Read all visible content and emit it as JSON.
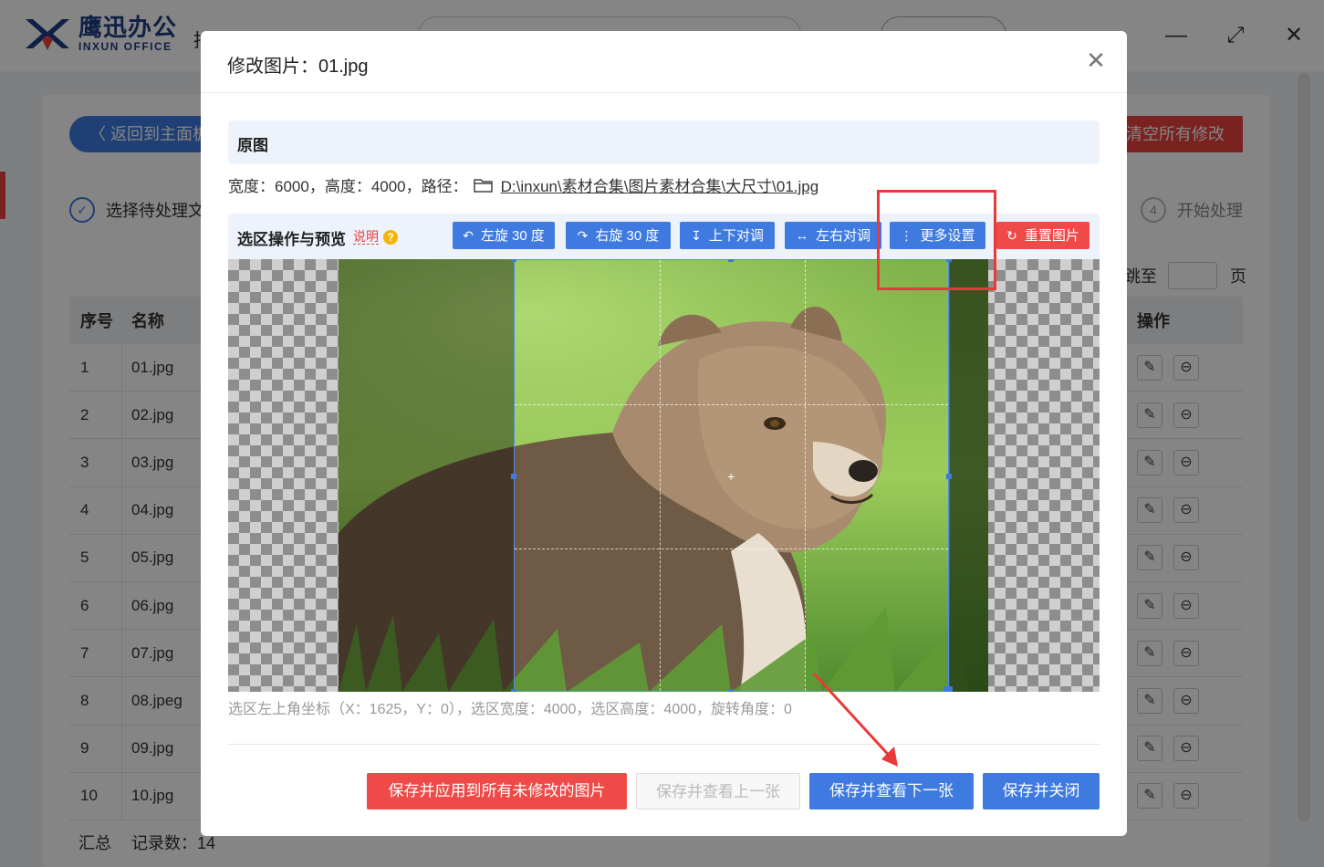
{
  "app": {
    "logo_cn": "鹰迅办公",
    "logo_en": "INXUN OFFICE",
    "title_fragment": "拍",
    "back_button": "返回到主面板",
    "clear_button": "清空所有修改",
    "step1_label": "选择待处理文",
    "step4_number": "4",
    "step4_label": "开始处理",
    "jump_to_label": "跳至",
    "page_label": "页",
    "table": {
      "headers": [
        "序号",
        "名称"
      ],
      "rows": [
        [
          "1",
          "01.jpg"
        ],
        [
          "2",
          "02.jpg"
        ],
        [
          "3",
          "03.jpg"
        ],
        [
          "4",
          "04.jpg"
        ],
        [
          "5",
          "05.jpg"
        ],
        [
          "6",
          "06.jpg"
        ],
        [
          "7",
          "07.jpg"
        ],
        [
          "8",
          "08.jpeg"
        ],
        [
          "9",
          "09.jpg"
        ],
        [
          "10",
          "10.jpg"
        ]
      ],
      "ops_header": "操作",
      "summary_label": "汇总",
      "record_count": "记录数：14"
    }
  },
  "modal": {
    "title": "修改图片：01.jpg",
    "original_section": "原图",
    "image_info": "宽度：6000，高度：4000，路径：",
    "image_path": "D:\\inxun\\素材合集\\图片素材合集\\大尺寸\\01.jpg",
    "ops_section": "选区操作与预览",
    "help_link": "说明",
    "help_icon": "?",
    "toolbar": [
      {
        "label": "左旋 30 度",
        "icon": "rotate-left-icon",
        "glyph": "↶"
      },
      {
        "label": "右旋 30 度",
        "icon": "rotate-right-icon",
        "glyph": "↷"
      },
      {
        "label": "上下对调",
        "icon": "flip-vertical-icon",
        "glyph": "↧"
      },
      {
        "label": "左右对调",
        "icon": "flip-horizontal-icon",
        "glyph": "↔"
      },
      {
        "label": "更多设置",
        "icon": "more-icon",
        "glyph": "⋮"
      },
      {
        "label": "重置图片",
        "icon": "reset-icon",
        "glyph": "↻"
      }
    ],
    "selection_info": "选区左上角坐标（X：1625，Y：0），选区宽度：4000，选区高度：4000，旋转角度：0",
    "footer": {
      "apply_all": "保存并应用到所有未修改的图片",
      "prev": "保存并查看上一张",
      "next": "保存并查看下一张",
      "close": "保存并关闭"
    }
  },
  "colors": {
    "primary": "#3e7ae0",
    "danger": "#ef4a47",
    "annotation": "#e83a3a"
  }
}
